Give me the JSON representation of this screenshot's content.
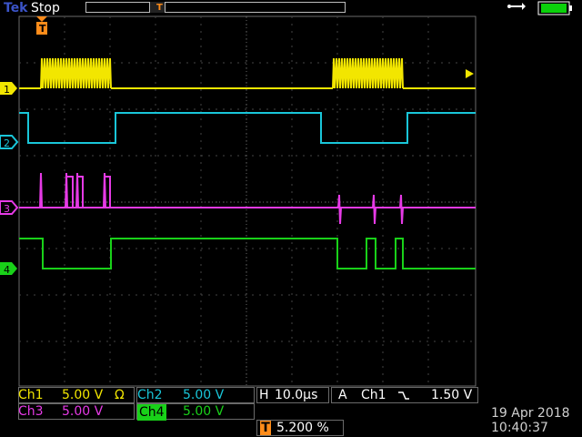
{
  "header": {
    "brand": "Tek",
    "run_state": "Stop",
    "trigger_marker": "T",
    "usb_icon": "usb-icon",
    "battery_icon": "battery-icon"
  },
  "channels": [
    {
      "id": "1",
      "label": "Ch1",
      "scale": "5.00 V",
      "coupling": "Ω",
      "color": "#f2e600"
    },
    {
      "id": "2",
      "label": "Ch2",
      "scale": "5.00 V",
      "color": "#19c6d9"
    },
    {
      "id": "3",
      "label": "Ch3",
      "scale": "5.00 V",
      "color": "#e63ae6"
    },
    {
      "id": "4",
      "label": "Ch4",
      "scale": "5.00 V",
      "color": "#19d119"
    }
  ],
  "horizontal": {
    "label": "H",
    "scale": "10.0µs"
  },
  "trigger": {
    "mode": "A",
    "source": "Ch1",
    "level": "1.50 V",
    "position_label": "T",
    "position_percent": "5.200 %"
  },
  "datetime": {
    "date": "19 Apr 2018",
    "time": "10:40:37"
  },
  "chart_data": {
    "type": "line",
    "grid": "10x8 divisions",
    "series": [
      {
        "name": "1",
        "values": "burst pulses at left and right"
      },
      {
        "name": "2",
        "values": "square wave with two low segments"
      },
      {
        "name": "3",
        "values": "spiky digital line"
      },
      {
        "name": "4",
        "values": "digital line with multiple transitions"
      }
    ]
  }
}
